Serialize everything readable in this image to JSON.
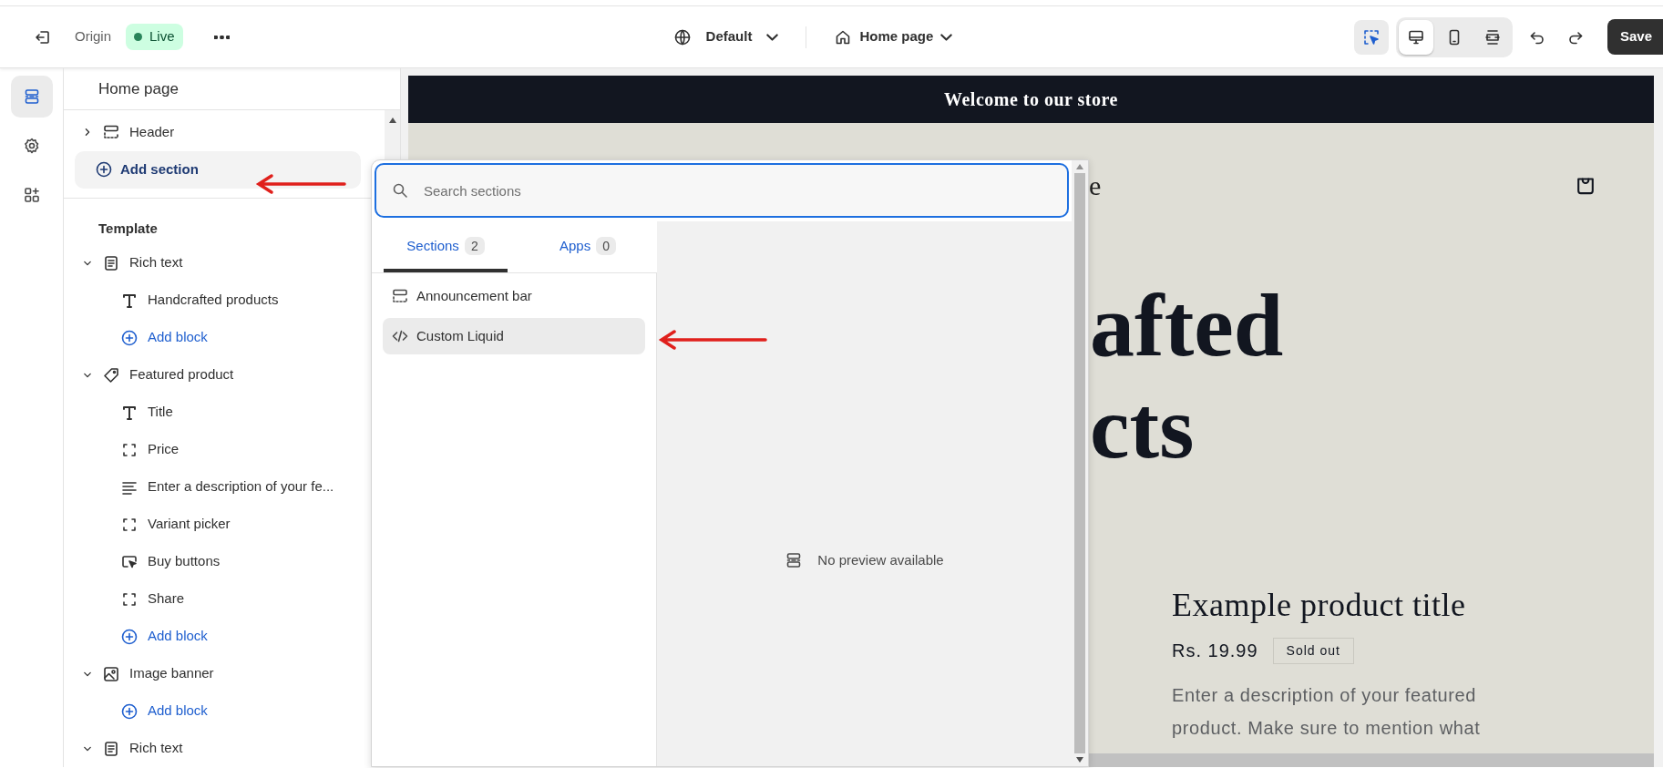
{
  "topbar": {
    "store_name": "Origin",
    "status": "Live",
    "theme": "Default",
    "page": "Home page",
    "inspector_on": true,
    "view_modes": [
      {
        "kind": "desktop",
        "selected": true
      },
      {
        "kind": "mobile",
        "selected": false
      },
      {
        "kind": "fullwidth",
        "selected": false
      }
    ],
    "save_label": "Save"
  },
  "rail": [
    {
      "kind": "sections",
      "selected": true
    },
    {
      "kind": "settings",
      "selected": false
    },
    {
      "kind": "apps",
      "selected": false
    }
  ],
  "panel": {
    "title": "Home page",
    "header_group": [
      {
        "label": "Header",
        "kind": "header",
        "expanded": false
      }
    ],
    "add_section": {
      "label": "Add section",
      "selected": true
    },
    "template_title": "Template",
    "sections": [
      {
        "label": "Rich text",
        "kind": "rich-text",
        "expanded": true,
        "children": [
          {
            "label": "Handcrafted products",
            "kind": "heading"
          },
          {
            "label": "Add block",
            "kind": "add"
          }
        ]
      },
      {
        "label": "Featured product",
        "kind": "product",
        "expanded": true,
        "children": [
          {
            "label": "Title",
            "kind": "heading"
          },
          {
            "label": "Price",
            "kind": "placeholder"
          },
          {
            "label": "Enter a description of your fe...",
            "kind": "paragraph"
          },
          {
            "label": "Variant picker",
            "kind": "placeholder"
          },
          {
            "label": "Buy buttons",
            "kind": "buy"
          },
          {
            "label": "Share",
            "kind": "placeholder"
          },
          {
            "label": "Add block",
            "kind": "add"
          }
        ]
      },
      {
        "label": "Image banner",
        "kind": "image",
        "expanded": true,
        "children": [
          {
            "label": "Add block",
            "kind": "add"
          }
        ]
      },
      {
        "label": "Rich text",
        "kind": "rich-text",
        "expanded": true
      }
    ]
  },
  "section_picker": {
    "placeholder": "Search sections",
    "tabs": [
      {
        "label": "Sections",
        "count": "2",
        "selected": true
      },
      {
        "label": "Apps",
        "count": "0",
        "selected": false
      }
    ],
    "items": [
      {
        "label": "Announcement bar",
        "kind": "announcement",
        "selected": false
      },
      {
        "label": "Custom Liquid",
        "kind": "liquid",
        "selected": true
      }
    ],
    "preview_message": "No preview available"
  },
  "store_preview": {
    "announcement": "Welcome to our store",
    "logo": "e",
    "hero_lines": [
      "afted",
      "cts"
    ],
    "product_title": "Example product title",
    "price": "Rs. 19.99",
    "badge": "Sold out",
    "description_lines": [
      "Enter a description of your featured",
      "product. Make sure to mention what"
    ]
  },
  "annotations": [
    {
      "kind": "arrow"
    },
    {
      "kind": "arrow"
    }
  ]
}
